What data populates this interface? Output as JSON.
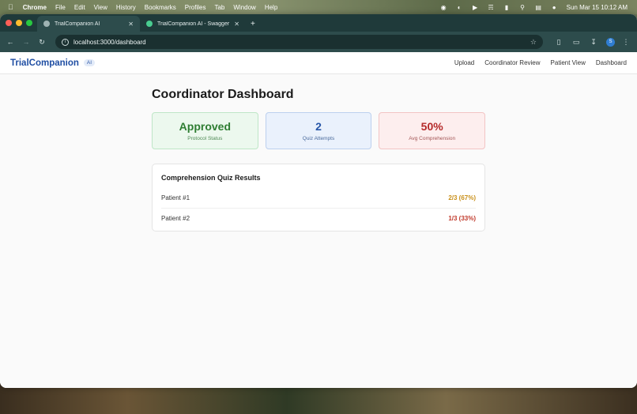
{
  "menubar": {
    "items": [
      "Chrome",
      "File",
      "Edit",
      "View",
      "History",
      "Bookmarks",
      "Profiles",
      "Tab",
      "Window",
      "Help"
    ],
    "clock": "Sun Mar 15  10:12 AM"
  },
  "browser": {
    "tabs": [
      {
        "label": "TrialCompanion AI",
        "active": true
      },
      {
        "label": "TrialCompanion AI - Swagger",
        "active": false
      }
    ],
    "url": "localhost:3000/dashboard",
    "profile_initial": "S"
  },
  "app": {
    "brand": "TrialCompanion",
    "badge": "AI",
    "nav": [
      "Upload",
      "Coordinator Review",
      "Patient View",
      "Dashboard"
    ]
  },
  "dashboard": {
    "title": "Coordinator Dashboard",
    "stats": [
      {
        "value": "Approved",
        "label": "Protocol Status"
      },
      {
        "value": "2",
        "label": "Quiz Attempts"
      },
      {
        "value": "50%",
        "label": "Avg Comprehension"
      }
    ],
    "results": {
      "title": "Comprehension Quiz Results",
      "rows": [
        {
          "patient": "Patient #1",
          "score": "2/3 (67%)",
          "color": "#c9901a"
        },
        {
          "patient": "Patient #2",
          "score": "1/3 (33%)",
          "color": "#c0392b"
        }
      ]
    }
  },
  "colors": {
    "brand": "#1f4ea3",
    "approved": "#2e7d32",
    "attempts": "#2756a8",
    "comprehension": "#b52a2a"
  }
}
